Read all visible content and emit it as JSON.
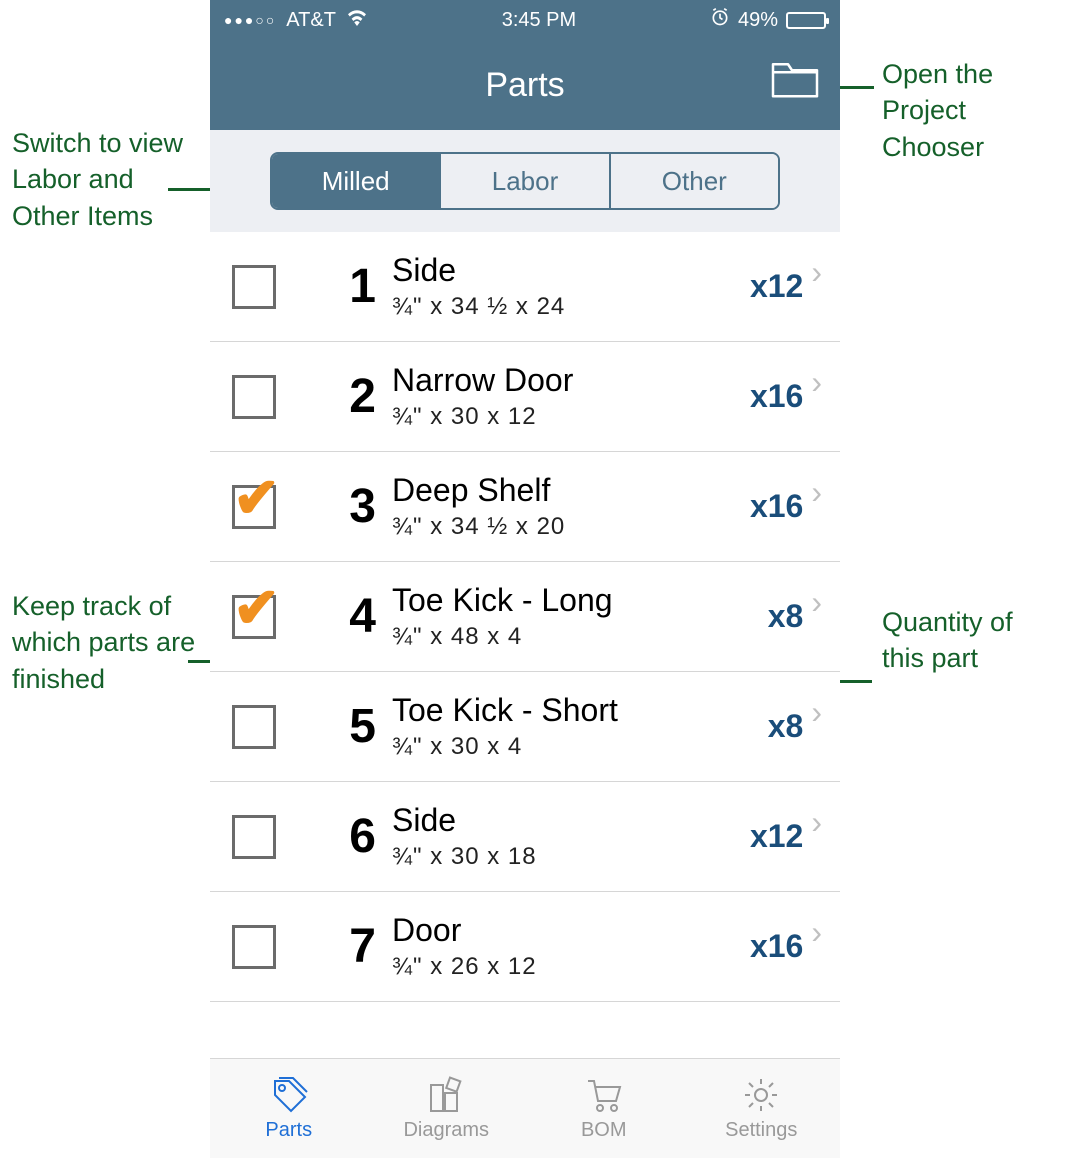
{
  "statusbar": {
    "carrier": "AT&T",
    "time": "3:45 PM",
    "battery_pct": "49%"
  },
  "navbar": {
    "title": "Parts"
  },
  "segments": {
    "milled": "Milled",
    "labor": "Labor",
    "other": "Other"
  },
  "rows": [
    {
      "num": "1",
      "name": "Side",
      "dim": "¾\"  x  34 ½  x  24",
      "qty": "x12",
      "checked": false
    },
    {
      "num": "2",
      "name": "Narrow Door",
      "dim": "¾\"  x  30  x  12",
      "qty": "x16",
      "checked": false
    },
    {
      "num": "3",
      "name": "Deep Shelf",
      "dim": "¾\"  x  34 ½  x  20",
      "qty": "x16",
      "checked": true
    },
    {
      "num": "4",
      "name": "Toe Kick - Long",
      "dim": "¾\"  x  48  x  4",
      "qty": "x8",
      "checked": true
    },
    {
      "num": "5",
      "name": "Toe Kick - Short",
      "dim": "¾\"  x  30  x  4",
      "qty": "x8",
      "checked": false
    },
    {
      "num": "6",
      "name": "Side",
      "dim": "¾\"  x  30  x  18",
      "qty": "x12",
      "checked": false
    },
    {
      "num": "7",
      "name": "Door",
      "dim": "¾\"  x  26  x  12",
      "qty": "x16",
      "checked": false
    }
  ],
  "tabs": {
    "parts": "Parts",
    "diagrams": "Diagrams",
    "bom": "BOM",
    "settings": "Settings"
  },
  "annotations": {
    "segments": "Switch to view Labor and Other Items",
    "folder": "Open the Project Chooser",
    "checkbox": "Keep track of which parts are finished",
    "qty": "Quantity of this part"
  }
}
